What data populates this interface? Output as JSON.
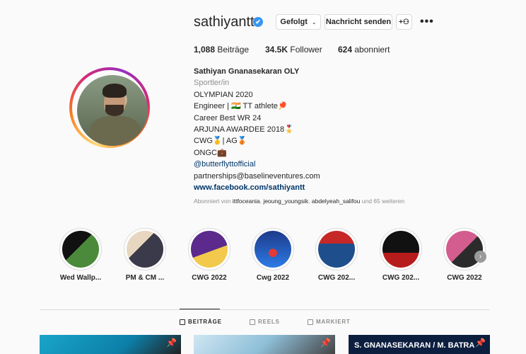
{
  "profile": {
    "username": "sathiyantt",
    "verified_label": "✔",
    "follow_button": "Gefolgt",
    "message_button": "Nachricht senden",
    "add_user_icon": "+ʟ",
    "more_icon": "•••"
  },
  "stats": {
    "posts_count": "1,088",
    "posts_label": "Beiträge",
    "followers_count": "34.5K",
    "followers_label": "Follower",
    "following_count": "624",
    "following_label": "abonniert"
  },
  "bio": {
    "name": "Sathiyan Gnanasekaran OLY",
    "category": "Sportler/in",
    "lines": [
      "OLYMPIAN 2020",
      "Engineer | 🇮🇳  TT athlete🏓",
      "Career Best WR 24",
      "ARJUNA AWARDEE 2018🎖️",
      "CWG🥇| AG🥉",
      "ONGC💼"
    ],
    "mention": "@butterflyttofficial",
    "email": "partnerships@baselineventures.com",
    "website": "www.facebook.com/sathiyantt"
  },
  "followed_by": {
    "prefix": "Abonniert von ",
    "users": [
      "ittfoceania",
      "jeoung_youngsik",
      "abdelyeah_salifou"
    ],
    "suffix": " und 65 weiteren"
  },
  "highlights": [
    {
      "label": "Wed Wallp..."
    },
    {
      "label": "PM & CM ..."
    },
    {
      "label": "CWG 2022"
    },
    {
      "label": "Cwg 2022"
    },
    {
      "label": "CWG 202..."
    },
    {
      "label": "CWG 202..."
    },
    {
      "label": "CWG 2022"
    }
  ],
  "tabs": [
    {
      "label": "BEITRÄGE",
      "icon": "grid-icon",
      "active": true
    },
    {
      "label": "REELS",
      "icon": "reels-icon",
      "active": false
    },
    {
      "label": "MARKIERT",
      "icon": "tagged-icon",
      "active": false
    }
  ],
  "posts": [
    {
      "title": ""
    },
    {
      "title": ""
    },
    {
      "title": "S. GNANASEKARAN / M. BATRA"
    }
  ],
  "colors": {
    "verified": "#3897f0",
    "link": "#00376b",
    "muted": "#8e8e8e"
  }
}
